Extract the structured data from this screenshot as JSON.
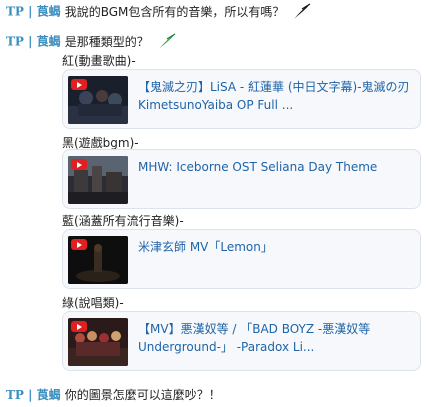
{
  "messages": [
    {
      "author": "TP | 莨蝎",
      "text": "我說的BGM包含所有的音樂，所以有嗎？"
    },
    {
      "author": "TP | 莨蝎",
      "text": "是那種類型的？"
    },
    {
      "author": "TP | 莨蝎",
      "text": "你的圖景怎麼可以這麼吵？！"
    }
  ],
  "categories": [
    {
      "label": "紅(動畫歌曲)-",
      "video_title": "【鬼滅之刃】LiSA - 紅蓮華 (中日文字幕)-鬼滅の刃 KimetsunoYaiba OP Full ..."
    },
    {
      "label": "黑(遊戲bgm)-",
      "video_title": "MHW: Iceborne OST Seliana Day Theme"
    },
    {
      "label": "藍(涵蓋所有流行音樂)-",
      "video_title": "米津玄師 MV「Lemon」"
    },
    {
      "label": "綠(說唱類)-",
      "video_title": "【MV】悪漢奴等 / 「BAD BOYZ -悪漢奴等 Underground-」 -Paradox Li..."
    }
  ],
  "colors": {
    "author": "#3c8fc0",
    "link": "#1f64a8",
    "card_bg": "#f6f8fb",
    "feather_black": "#111111",
    "feather_green": "#2aa84a",
    "youtube_red": "#e02020"
  }
}
